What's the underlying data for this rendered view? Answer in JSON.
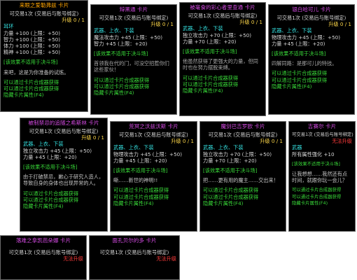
{
  "cards": [
    {
      "title": "来眼之爱勒弗兹 卡片",
      "title_color": "orange",
      "trade": "可交易1次 (交易后与账号绑定)",
      "upgrade": "升级 0 / 1",
      "slots": "耳环",
      "stats": [
        "力量 +100 (上限：+50)",
        "智力 +100 (上限：+50)",
        "体力 +100 (上限：+50)",
        "精神 +100 (上限：+50)"
      ],
      "unsuitable": "[该效果不适用于决斗场]",
      "flavor": "来吧，这是为你准备的试炼。",
      "line1": "可以通过卡片合成器获得",
      "line2": "可以通过卡片合成器获得",
      "hidden": "隐藏卡片属性(F4)"
    },
    {
      "title": "辩黑通 卡片",
      "trade": "可交易1次 (交易后与账号绑定)",
      "upgrade": "升级 0 / 1",
      "slots": "武器、上衣、下装",
      "stats": [
        "魔法攻击力 +45 (上限：+50)",
        "智力 +45 (上限：+20)"
      ],
      "unsuitable": "[该效果不适用于决斗场]",
      "flavor": "首领我在代的门，可没空招惹你们这些家伙！",
      "line1": "可以通过卡片合成器获得",
      "line2": "可以通过卡片合成器获得",
      "hidden": "隐藏卡片属性(F4)"
    },
    {
      "title": "被毫食的彩心者里查通 卡片",
      "trade": "可交易1次 (交易后与账号绑定)",
      "upgrade": "升级 0 / 1",
      "slots": "武器、上衣、下装",
      "stats": [
        "独立攻击力 +70 (上限：+50)",
        "力量 +70 (上限：+20)"
      ],
      "unsuitable": "[该效果不适用于决斗场]",
      "flavor": "他虽然获得了更强大的力量，但同时也在努力摆脱束缚。",
      "line1": "可以通过卡片合成器获得",
      "line2": "可以通过卡片合成器获得",
      "hidden": "隐藏卡片属性(F4)"
    },
    {
      "title": "银白哈可儿 卡片",
      "trade": "可交易1次 (交易后与账号绑定)",
      "upgrade": "升级 0 / 1",
      "slots": "武器、上衣、下装",
      "stats": [
        "物理攻击力 +45 (上限：+50)",
        "力量 +45 (上限：+20)"
      ],
      "unsuitable": "[该效果不适用于决斗场]",
      "flavor": "四解同路：是那可儿的特技。",
      "line1": "可以通过卡片合成器获得",
      "line2": "可以通过卡片合成器获得",
      "hidden": "隐藏卡片属性(F4)"
    },
    {
      "title": "被制禁忌的追随之希斯林 卡片",
      "trade": "可交易1次 (交易后与账号绑定)",
      "upgrade": "升级 0 / 1",
      "slots": "武器、上衣、下装",
      "stats": [
        "独立攻击力 +45 (上限：+50)",
        "力量 +45 (上限：+20)"
      ],
      "unsuitable": "[该效果不适用于决斗场]",
      "flavor": "由于打破禁忌，歉心于研究人造人，导致自身的身体也出现异常的人。",
      "line1": "可以通过卡片合成器获得",
      "line2": "可以通过卡片合成器获得",
      "hidden": "隐藏卡片属性(F4)"
    },
    {
      "title": "荒冥之沃兹沃斯 卡片",
      "trade": "可交易1次 (交易后与账号绑定)",
      "upgrade": "升级 0 / 1",
      "slots": "武器、上衣、下装",
      "stats": [
        "物理攻击力 +45 (上限：+50)",
        "力量 +45 (上限：+20)"
      ],
      "unsuitable": "[该效果不适用于决斗场]",
      "flavor": "嘶……新世的神明!!",
      "line1": "可以通过卡片合成器获得",
      "line2": "可以通过卡片合成器获得",
      "hidden": "隐藏卡片属性(F4)"
    },
    {
      "title": "魔剑巴吉罗欧 卡片",
      "trade": "可交易1次 (交易后与账号绑定)",
      "upgrade": "升级 0 / 1",
      "slots": "武器、上衣、下装",
      "stats": [
        "独立攻击力 +70 (上限：+50)",
        "力量 +70 (上限：+20)"
      ],
      "unsuitable": "[该效果不适用于决斗场]",
      "flavor": "把……更有用的魔主……交出来！",
      "line1": "可以通过卡片合成器获得",
      "line2": "可以通过卡片合成器获得",
      "hidden": "隐藏卡片属性(F4)"
    },
    {
      "title": "吉赛尔 卡片",
      "trade": "可交易1次 (交易后与账号绑定)",
      "upgrade": "升级 0 / 1",
      "badge": "无法升级",
      "slots": "武器",
      "stats": [
        "所有属性强化 +10"
      ],
      "unsuitable": "[该效果不适用于决斗场]",
      "flavor": "让我想想……我然还有点时间，就跟你玩一会儿？",
      "line1": "可以通过卡片合成器获得",
      "line2": "可以通过卡片合成器获得",
      "hidden": "隐藏卡片属性(F4)"
    },
    {
      "title": "落难之拿凯芭朵娜 卡片",
      "trade": "可交易1次 (交易后与账号绑定)",
      "badge": "无法升级"
    },
    {
      "title": "面孔贝尔的多 卡片",
      "trade": "可交易1次 (交易后与账号绑定)",
      "badge": "无法升级"
    }
  ]
}
